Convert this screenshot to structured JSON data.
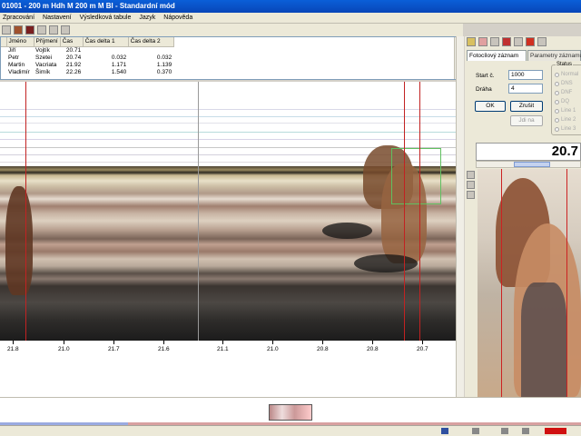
{
  "window": {
    "title": "01001 - 200 m Hdh M 200 m M Bl - Standardní mód"
  },
  "menu": [
    "Zpracování",
    "Nastavení",
    "Výsledková tabule",
    "Jazyk",
    "Nápověda"
  ],
  "results": {
    "headers": [
      "",
      "Jméno",
      "Příjmení",
      "Čas",
      "Čas delta 1",
      "Čas delta 2"
    ],
    "rows": [
      [
        "",
        "Jiří",
        "Vojtík",
        "20.71",
        "",
        ""
      ],
      [
        "",
        "Petr",
        "Szetei",
        "20.74",
        "0.032",
        "0.032"
      ],
      [
        "",
        "Martin",
        "Vacriata",
        "21.92",
        "1.171",
        "1.139"
      ],
      [
        "",
        "Vladimír",
        "Šimík",
        "22.26",
        "1.540",
        "0.370"
      ],
      [
        "",
        "",
        "",
        "",
        "",
        ""
      ]
    ]
  },
  "axis_ticks": [
    "21.8",
    "21.0",
    "21.7",
    "21.6",
    "21.1",
    "21.0",
    "20.8",
    "20.8",
    "20.7"
  ],
  "right_panel": {
    "tab_active": "Fotocílový záznam",
    "tab_inactive": "Parametry záznamu",
    "start_label": "Start č.",
    "start_value": "1000",
    "draha_label": "Dráha",
    "draha_value": "4",
    "ok_label": "OK",
    "zrusit_label": "Zrušit",
    "jdi_label": "Jdi na",
    "group_title": "Status",
    "radios": [
      "Normal",
      "DNS",
      "DNF",
      "DQ",
      "Line 1",
      "Line 2",
      "Line 3"
    ],
    "time": "20.7"
  },
  "colors": {
    "title_bg": "#0a5fd8",
    "marker_red": "#c22222"
  }
}
